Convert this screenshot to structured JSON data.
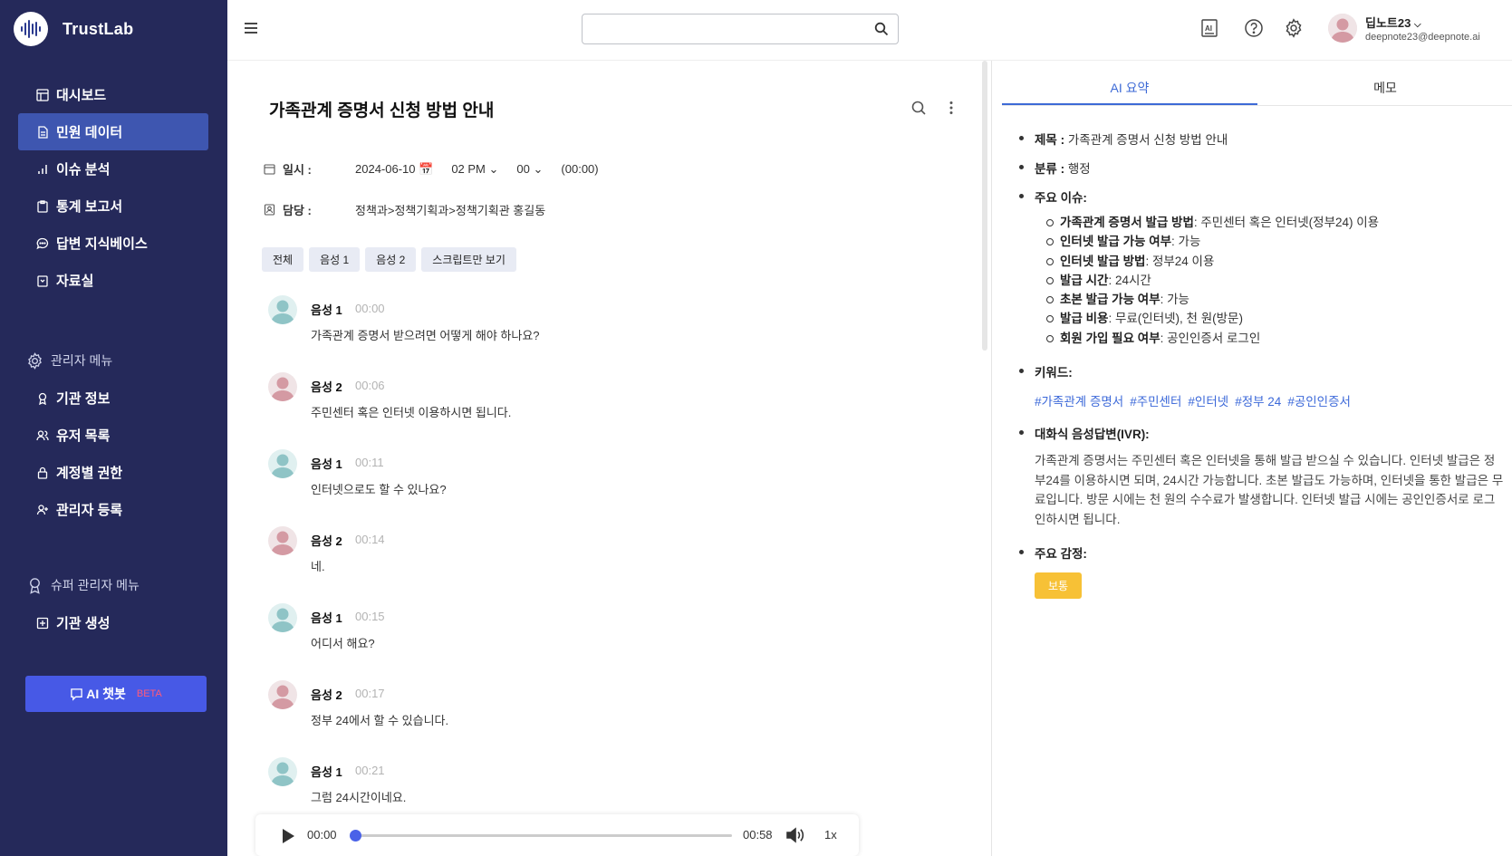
{
  "brand": {
    "name": "TrustLab"
  },
  "sidebar": {
    "items": [
      {
        "label": "대시보드",
        "icon": "dashboard-icon",
        "active": false
      },
      {
        "label": "민원 데이터",
        "icon": "document-icon",
        "active": true
      },
      {
        "label": "이슈 분석",
        "icon": "bar-chart-icon",
        "active": false
      },
      {
        "label": "통계 보고서",
        "icon": "clipboard-icon",
        "active": false
      },
      {
        "label": "답변 지식베이스",
        "icon": "chat-bubble-icon",
        "active": false
      },
      {
        "label": "자료실",
        "icon": "archive-icon",
        "active": false
      }
    ],
    "admin_group": "관리자 메뉴",
    "admin_items": [
      {
        "label": "기관 정보",
        "icon": "award-icon"
      },
      {
        "label": "유저 목록",
        "icon": "users-icon"
      },
      {
        "label": "계정별 권한",
        "icon": "lock-icon"
      },
      {
        "label": "관리자 등록",
        "icon": "user-plus-icon"
      }
    ],
    "super_group": "슈퍼 관리자 메뉴",
    "super_items": [
      {
        "label": "기관 생성",
        "icon": "plus-square-icon"
      }
    ],
    "ai_button": {
      "label": "AI 챗봇",
      "badge": "BETA"
    }
  },
  "topbar": {
    "search": {
      "value": "",
      "placeholder": ""
    },
    "user": {
      "name": "딥노트23",
      "email": "deepnote23@deepnote.ai"
    }
  },
  "conversation": {
    "title": "가족관계 증명서 신청 방법 안내",
    "date_label": "일시 :",
    "date": "2024-06-10",
    "hour": "02 PM",
    "minute": "00",
    "duration": "(00:00)",
    "owner_label": "담당 :",
    "owner": "정책과>정책기획과>정책기획관 홍길동",
    "filters": [
      "전체",
      "음성 1",
      "음성 2",
      "스크립트만 보기"
    ],
    "messages": [
      {
        "speaker": "음성 1",
        "time": "00:00",
        "text": "가족관계 증명서 받으려면 어떻게 해야 하나요?"
      },
      {
        "speaker": "음성 2",
        "time": "00:06",
        "text": "주민센터 혹은 인터넷 이용하시면 됩니다."
      },
      {
        "speaker": "음성 1",
        "time": "00:11",
        "text": "인터넷으로도 할 수 있나요?"
      },
      {
        "speaker": "음성 2",
        "time": "00:14",
        "text": "네."
      },
      {
        "speaker": "음성 1",
        "time": "00:15",
        "text": "어디서 해요?"
      },
      {
        "speaker": "음성 2",
        "time": "00:17",
        "text": "정부 24에서 할 수 있습니다."
      },
      {
        "speaker": "음성 1",
        "time": "00:21",
        "text": "그럼 24시간이네요."
      }
    ],
    "player": {
      "current": "00:00",
      "total": "00:58",
      "speed": "1x",
      "progress": 0
    }
  },
  "right_panel": {
    "tabs": [
      "AI 요약",
      "메모"
    ],
    "summary": {
      "title_label": "제목 :",
      "title_value": "가족관계 증명서 신청 방법 안내",
      "category_label": "분류 :",
      "category_value": "행정",
      "issues_label": "주요 이슈:",
      "issues": [
        {
          "key": "가족관계 증명서 발급 방법",
          "value": ": 주민센터 혹은 인터넷(정부24) 이용"
        },
        {
          "key": "인터넷 발급 가능 여부",
          "value": ": 가능"
        },
        {
          "key": "인터넷 발급 방법",
          "value": ": 정부24 이용"
        },
        {
          "key": "발급 시간",
          "value": ": 24시간"
        },
        {
          "key": "초본 발급 가능 여부",
          "value": ": 가능"
        },
        {
          "key": "발급 비용",
          "value": ": 무료(인터넷), 천 원(방문)"
        },
        {
          "key": "회원 가입 필요 여부",
          "value": ": 공인인증서 로그인"
        }
      ],
      "keywords_label": "키워드:",
      "keywords": [
        "#가족관계 증명서",
        "#주민센터",
        "#인터넷",
        "#정부 24",
        "#공인인증서"
      ],
      "ivr_label": "대화식 음성답변(IVR):",
      "ivr_text": "가족관계 증명서는 주민센터 혹은 인터넷을 통해 발급 받으실 수 있습니다. 인터넷 발급은 정부24를 이용하시면 되며, 24시간 가능합니다. 초본 발급도 가능하며, 인터넷을 통한 발급은 무료입니다. 방문 시에는 천 원의 수수료가 발생합니다. 인터넷 발급 시에는 공인인증서로 로그인하시면 됩니다.",
      "emotion_label": "주요 감정:",
      "emotion_value": "보통"
    }
  },
  "colors": {
    "sidebar_bg": "#25295a",
    "active": "#3e56b0",
    "accent": "#3d6ad6",
    "ai_button": "#4759e6",
    "emotion_badge": "#f7c136"
  }
}
